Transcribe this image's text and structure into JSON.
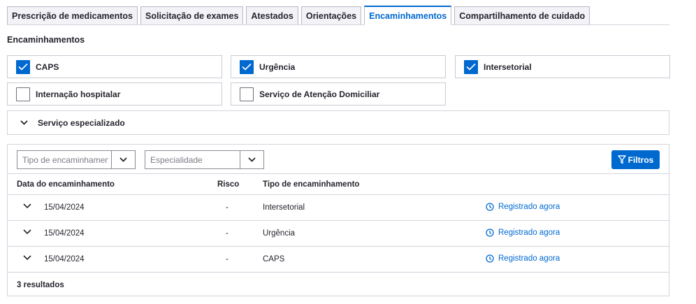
{
  "tabs": [
    {
      "label": "Prescrição de medicamentos",
      "active": false
    },
    {
      "label": "Solicitação de exames",
      "active": false
    },
    {
      "label": "Atestados",
      "active": false
    },
    {
      "label": "Orientações",
      "active": false
    },
    {
      "label": "Encaminhamentos",
      "active": true
    },
    {
      "label": "Compartilhamento de cuidado",
      "active": false
    }
  ],
  "section_title": "Encaminhamentos",
  "checkboxes": [
    {
      "label": "CAPS",
      "checked": true
    },
    {
      "label": "Urgência",
      "checked": true
    },
    {
      "label": "Intersetorial",
      "checked": true
    },
    {
      "label": "Internação hospitalar",
      "checked": false
    },
    {
      "label": "Serviço de Atenção Domiciliar",
      "checked": false
    }
  ],
  "accordion": {
    "label": "Serviço especializado",
    "icon": "chevron-down-icon"
  },
  "filters": {
    "tipo_placeholder": "Tipo de encaminhamento",
    "especialidade_placeholder": "Especialidade",
    "button_label": "Filtros",
    "button_icon": "filter-icon"
  },
  "table": {
    "columns": [
      "Data do encaminhamento",
      "Risco",
      "Tipo de encaminhamento"
    ],
    "rows": [
      {
        "date": "15/04/2024",
        "risk": "-",
        "type": "Intersetorial",
        "status": "Registrado agora"
      },
      {
        "date": "15/04/2024",
        "risk": "-",
        "type": "Urgência",
        "status": "Registrado agora"
      },
      {
        "date": "15/04/2024",
        "risk": "-",
        "type": "CAPS",
        "status": "Registrado agora"
      }
    ],
    "result_count": "3 resultados"
  },
  "colors": {
    "primary": "#0069d0",
    "border": "#d3d4dd",
    "text": "#24252e"
  }
}
